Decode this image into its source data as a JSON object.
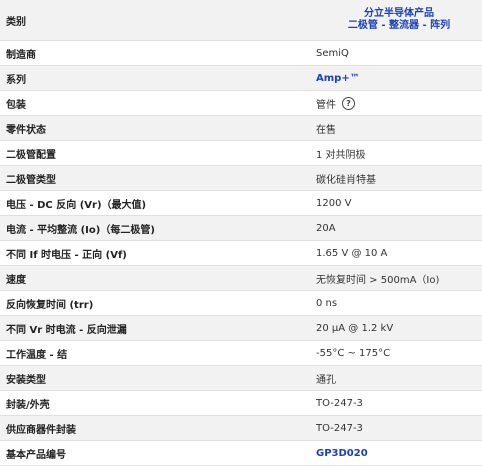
{
  "rows": [
    {
      "label": "类别",
      "value_lines": [
        "分立半导体产品",
        "二极管 - 整流器 - 阵列"
      ],
      "link": true
    },
    {
      "label": "制造商",
      "value": "SemiQ"
    },
    {
      "label": "系列",
      "value": "Amp+™",
      "link": true
    },
    {
      "label": "包装",
      "value": "管件",
      "help": "?"
    },
    {
      "label": "零件状态",
      "value": "在售"
    },
    {
      "label": "二极管配置",
      "value": "1 对共阴极"
    },
    {
      "label": "二极管类型",
      "value": "碳化硅肖特基"
    },
    {
      "label": "电压 - DC 反向 (Vr)（最大值)",
      "value": "1200 V"
    },
    {
      "label": "电流 - 平均整流 (Io)（每二极管)",
      "value": "20A"
    },
    {
      "label": "不同 If 时电压 - 正向 (Vf)",
      "value": "1.65 V @ 10 A"
    },
    {
      "label": "速度",
      "value": "无恢复时间 > 500mA（Io)"
    },
    {
      "label": "反向恢复时间 (trr)",
      "value": "0 ns"
    },
    {
      "label": "不同 Vr 时电流 - 反向泄漏",
      "value": "20 µA @ 1.2 kV"
    },
    {
      "label": "工作温度 - 结",
      "value": "-55°C ~ 175°C"
    },
    {
      "label": "安装类型",
      "value": "通孔"
    },
    {
      "label": "封装/外壳",
      "value": "TO-247-3"
    },
    {
      "label": "供应商器件封装",
      "value": "TO-247-3"
    },
    {
      "label": "基本产品编号",
      "value": "GP3D020",
      "link": true
    }
  ]
}
